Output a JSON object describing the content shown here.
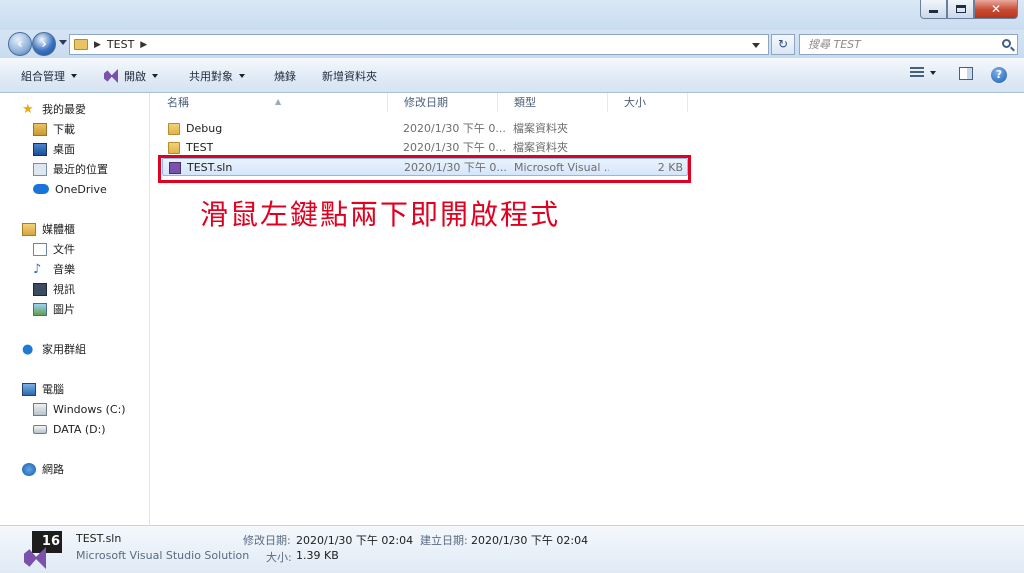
{
  "window": {
    "controls": {
      "minimize": "minimize-icon",
      "maximize": "maximize-icon",
      "close": "close-icon",
      "close_glyph": "✕"
    }
  },
  "address": {
    "crumb": "TEST",
    "search_placeholder": "搜尋 TEST"
  },
  "toolbar": {
    "organize": "組合管理",
    "open": "開啟",
    "share": "共用對象",
    "burn": "燒錄",
    "new_folder": "新增資料夾"
  },
  "nav": {
    "favorites": "我的最愛",
    "downloads": "下載",
    "desktop": "桌面",
    "recent": "最近的位置",
    "onedrive": "OneDrive",
    "libraries": "媒體櫃",
    "documents": "文件",
    "music": "音樂",
    "videos": "視訊",
    "pictures": "圖片",
    "homegroup": "家用群組",
    "computer": "電腦",
    "drive_c": "Windows (C:)",
    "drive_d": "DATA (D:)",
    "network": "網路"
  },
  "columns": {
    "name": "名稱",
    "date": "修改日期",
    "type": "類型",
    "size": "大小"
  },
  "files": [
    {
      "name": "Debug",
      "date": "2020/1/30 下午 0...",
      "type": "檔案資料夾",
      "size": "",
      "kind": "folder"
    },
    {
      "name": "TEST",
      "date": "2020/1/30 下午 0...",
      "type": "檔案資料夾",
      "size": "",
      "kind": "folder"
    },
    {
      "name": "TEST.sln",
      "date": "2020/1/30 下午 0...",
      "type": "Microsoft Visual ...",
      "size": "2 KB",
      "kind": "solution",
      "selected": true
    }
  ],
  "annotation": "滑鼠左鍵點兩下即開啟程式",
  "details": {
    "icon_version": "16",
    "file_name": "TEST.sln",
    "file_type": "Microsoft Visual Studio Solution",
    "modified_label": "修改日期:",
    "modified_value": "2020/1/30 下午 02:04",
    "created_label": "建立日期:",
    "created_value": "2020/1/30 下午 02:04",
    "size_label": "大小:",
    "size_value": "1.39 KB"
  }
}
